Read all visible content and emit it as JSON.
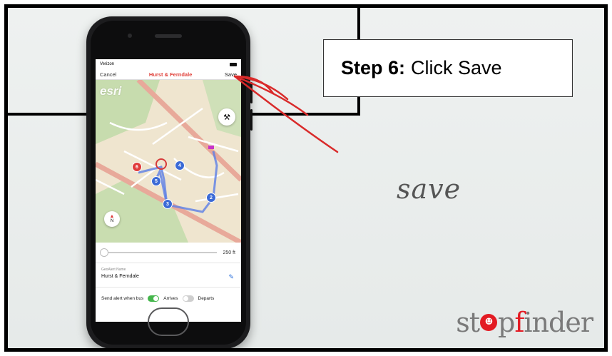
{
  "phone": {
    "status": {
      "carrier": "Verizon"
    },
    "nav": {
      "cancel": "Cancel",
      "title": "Hurst & Ferndale",
      "save": "Save"
    },
    "map": {
      "watermark": "esri",
      "tools_icon": "tools-icon",
      "compass_icon": "compass-icon",
      "stops": [
        {
          "label": "6",
          "color": "#e03a3a"
        },
        {
          "label": "5",
          "color": "#3b6ad6"
        },
        {
          "label": "4",
          "color": "#3b6ad6"
        },
        {
          "label": "3",
          "color": "#3b6ad6"
        },
        {
          "label": "2",
          "color": "#3b6ad6"
        }
      ]
    },
    "slider": {
      "value": "250 ft",
      "level": 0.0
    },
    "geoalert": {
      "label": "GeoAlert Name",
      "value": "Hurst & Ferndale"
    },
    "alert": {
      "label": "Send alert when bus",
      "arrives": "Arrives",
      "departs": "Departs",
      "arrives_on": true,
      "departs_on": false
    }
  },
  "instruction": {
    "step": "Step 6:",
    "text": "Click Save"
  },
  "annotation": {
    "handwritten": "save"
  },
  "brand": {
    "logo_pre": "st",
    "logo_mid": "p",
    "logo_post": "inder",
    "accent": "#e31b23"
  }
}
